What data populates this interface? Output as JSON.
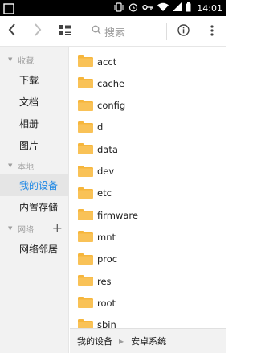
{
  "status_bar": {
    "time": "14:01",
    "icons": [
      "notification-icon",
      "vibrate-icon",
      "alarm-icon",
      "key-icon",
      "wifi-icon",
      "signal-icon",
      "battery-icon"
    ]
  },
  "toolbar": {
    "search_placeholder": "搜索",
    "icons": [
      "back-icon",
      "forward-icon",
      "view-toggle-icon",
      "search-icon",
      "info-icon",
      "more-icon"
    ]
  },
  "sidebar": {
    "sections": [
      {
        "title": "收藏",
        "items": [
          "下载",
          "文档",
          "相册",
          "图片"
        ]
      },
      {
        "title": "本地",
        "items": [
          "我的设备",
          "内置存储"
        ],
        "selected": "我的设备"
      },
      {
        "title": "网络",
        "items": [
          "网络邻居"
        ],
        "has_add": true
      }
    ]
  },
  "file_list": {
    "items": [
      "acct",
      "cache",
      "config",
      "d",
      "data",
      "dev",
      "etc",
      "firmware",
      "mnt",
      "proc",
      "res",
      "root",
      "sbin"
    ]
  },
  "path_bar": {
    "segments": [
      "我的设备",
      "安卓系统"
    ]
  },
  "colors": {
    "accent": "#1e88e5",
    "folder": "#f6b63c",
    "sidebar_bg": "#f2f2f2",
    "status_bar": "#000000"
  }
}
